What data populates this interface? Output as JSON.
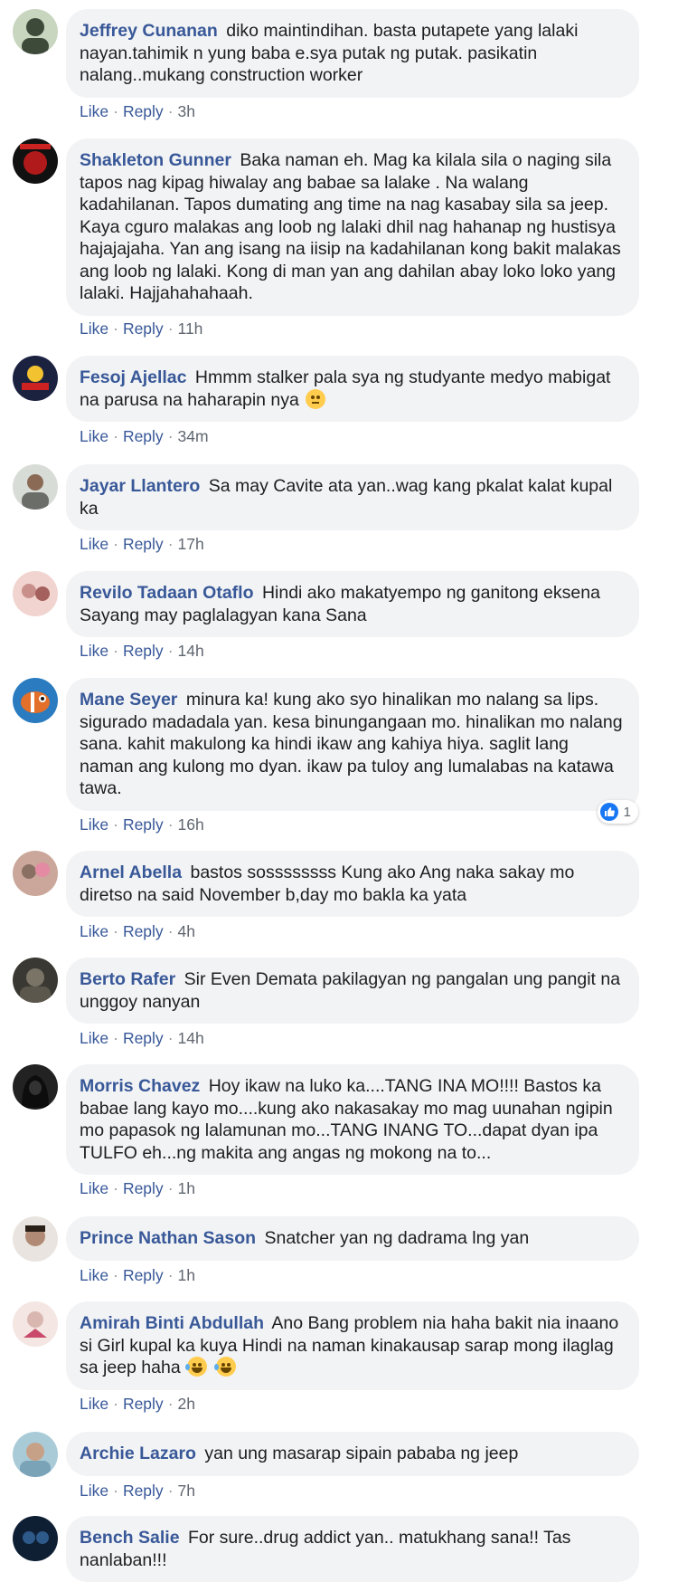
{
  "actions": {
    "like": "Like",
    "reply": "Reply",
    "sep": "·"
  },
  "comments": [
    {
      "author": "Jeffrey Cunanan",
      "text": "diko maintindihan. basta putapete yang lalaki nayan.tahimik n yung baba e.sya putak ng putak. pasikatin nalang..mukang construction worker",
      "time": "3h",
      "avatar_color": "#3d4a3a"
    },
    {
      "author": "Shakleton Gunner",
      "text": "Baka naman eh. Mag ka kilala sila o naging sila tapos nag kipag hiwalay ang babae sa lalake . Na walang kadahilanan. Tapos dumating ang time na nag kasabay sila sa jeep. Kaya cguro malakas ang loob ng lalaki dhil nag hahanap ng hustisya hajajajaha. Yan ang isang na iisip na kadahilanan kong bakit malakas ang loob ng lalaki. Kong di man yan ang dahilan abay loko loko yang lalaki. Hajjahahahaah.",
      "time": "11h",
      "avatar_color": "#111111"
    },
    {
      "author": "Fesoj Ajellac",
      "text": "Hmmm stalker pala sya ng studyante medyo mabigat na parusa na haharapin nya",
      "emoji": "thinking",
      "time": "34m",
      "avatar_color": "#1b2240"
    },
    {
      "author": "Jayar Llantero",
      "text": "Sa may Cavite ata yan..wag kang pkalat kalat kupal ka",
      "time": "17h",
      "avatar_color": "#8a8f86"
    },
    {
      "author": "Revilo Tadaan Otaflo",
      "text": "Hindi ako makatyempo ng ganitong eksena Sayang may paglalagyan kana Sana",
      "time": "14h",
      "avatar_color": "#c98f8a"
    },
    {
      "author": "Mane Seyer",
      "text": "minura ka! kung ako syo hinalikan mo nalang sa lips. sigurado madadala yan. kesa binungangaan mo. hinalikan mo nalang sana. kahit makulong ka hindi ikaw ang kahiya hiya. saglit lang naman ang kulong mo dyan. ikaw pa tuloy ang lumalabas na katawa tawa.",
      "time": "16h",
      "reaction_count": "1",
      "avatar_color": "#e2702a"
    },
    {
      "author": "Arnel Abella",
      "text": "bastos sossssssss Kung ako Ang naka sakay mo diretso na said November b,day mo bakla ka yata",
      "time": "4h",
      "avatar_color": "#8a6f63"
    },
    {
      "author": "Berto Rafer",
      "text": "Sir Even Demata pakilagyan ng pangalan ung pangit na unggoy nanyan",
      "time": "14h",
      "avatar_color": "#4d4a42"
    },
    {
      "author": "Morris Chavez",
      "text": "Hoy ikaw na luko ka....TANG INA MO!!!! Bastos ka babae lang kayo mo....kung ako nakasakay mo mag uunahan ngipin mo papasok ng lalamunan mo...TANG INANG TO...dapat dyan ipa TULFO eh...ng makita ang angas ng mokong na to...",
      "time": "1h",
      "avatar_color": "#1a1a1a"
    },
    {
      "author": "Prince Nathan Sason",
      "text": "Snatcher yan ng dadrama lng yan",
      "time": "1h",
      "avatar_color": "#b08a74"
    },
    {
      "author": "Amirah Binti Abdullah",
      "text": "Ano Bang problem nia haha bakit nia inaano si Girl kupal ka kuya Hindi na naman kinakausap sarap mong ilaglag sa jeep haha",
      "emoji": "laughing",
      "emoji_count": 2,
      "time": "2h",
      "avatar_color": "#d9b7b0"
    },
    {
      "author": "Archie Lazaro",
      "text": "yan ung masarap sipain pababa ng jeep",
      "time": "7h",
      "avatar_color": "#7aa3b8"
    },
    {
      "author": "Bench Salie",
      "text": "For sure..drug addict yan.. matukhang sana!! Tas nanlaban!!!",
      "avatar_color": "#2e5a8a"
    }
  ]
}
